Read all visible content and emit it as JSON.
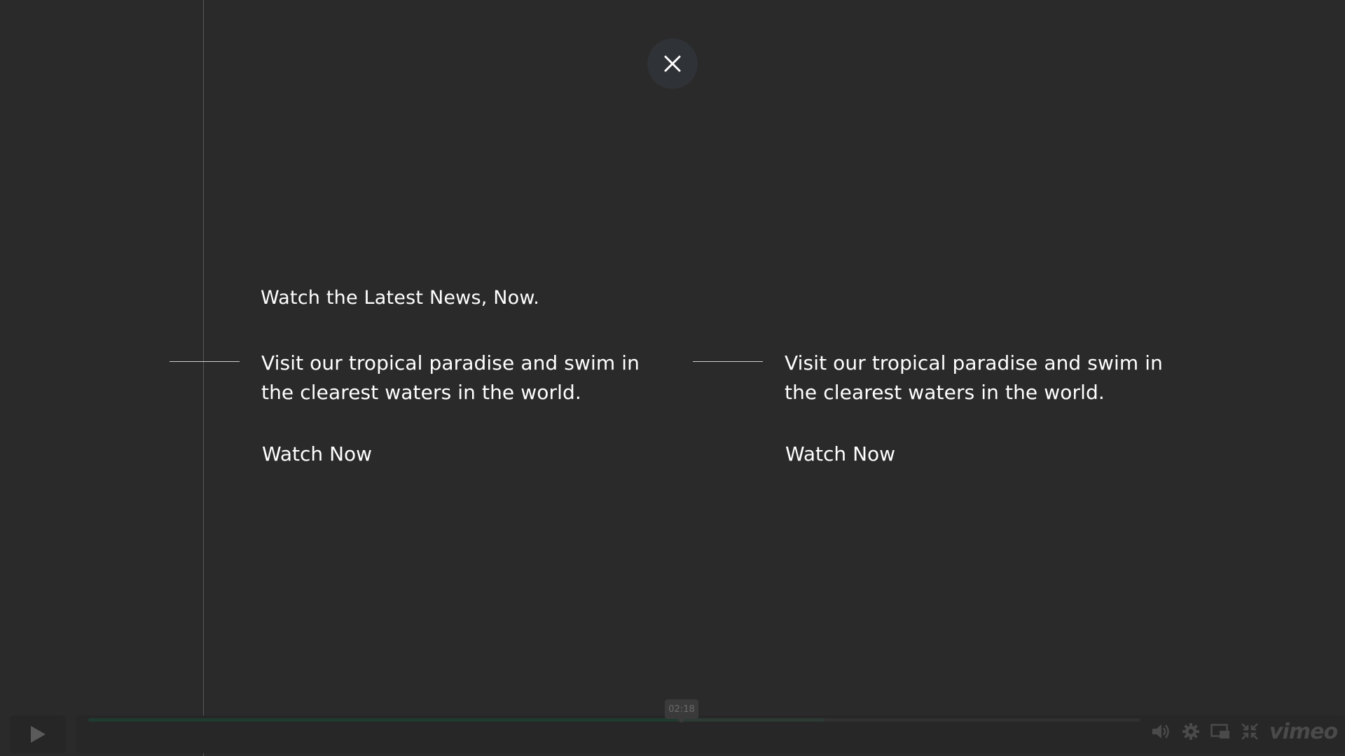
{
  "overlay": {
    "close_icon": "close-icon",
    "headline": "Watch the Latest News, Now.",
    "items": [
      {
        "text": "Visit our tropical paradise and swim in the clearest waters in the world.",
        "cta": "Watch Now"
      },
      {
        "text": "Visit our tropical paradise and swim in the clearest waters in the world.",
        "cta": "Watch Now"
      }
    ]
  },
  "player": {
    "play_icon": "play-icon",
    "time_tooltip": "02:18",
    "progress_fraction": 0.56,
    "buffered_fraction": 0.7,
    "controls": [
      "volume-icon",
      "settings-icon",
      "pip-icon",
      "fullscreen-exit-icon"
    ],
    "brand": "vimeo",
    "colors": {
      "progress": "#1f3a2e",
      "background": "#2a2a2a"
    }
  }
}
